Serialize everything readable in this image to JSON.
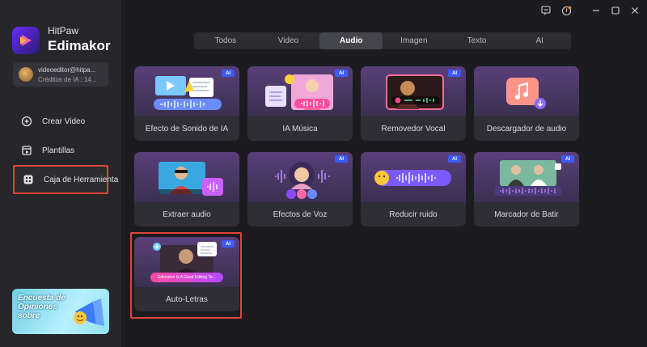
{
  "brand": {
    "line1": "HitPaw",
    "line2": "Edimakor"
  },
  "account": {
    "email": "videoeditor@hitpa...",
    "credits": "Créditos de IA : 14..."
  },
  "nav": [
    {
      "label": "Crear Video",
      "icon": "add-video-icon"
    },
    {
      "label": "Plantillas",
      "icon": "templates-icon"
    },
    {
      "label": "Caja de Herramienta",
      "icon": "toolbox-icon",
      "active": true
    }
  ],
  "promo": {
    "text": "Encuesta de Opiniones sobre"
  },
  "window_controls": [
    "feedback-icon",
    "notification-icon",
    "minimize-icon",
    "maximize-icon",
    "close-icon"
  ],
  "tabs": [
    {
      "label": "Todos"
    },
    {
      "label": "Video"
    },
    {
      "label": "Audio",
      "active": true
    },
    {
      "label": "Imagen"
    },
    {
      "label": "Texto"
    },
    {
      "label": "AI"
    }
  ],
  "badge_label": "AI",
  "tools": [
    {
      "name": "Efecto de Sonido de IA",
      "ai": true
    },
    {
      "name": "IA Música",
      "ai": true
    },
    {
      "name": "Removedor Vocal",
      "ai": true
    },
    {
      "name": "Descargador de audio",
      "ai": false
    },
    {
      "name": "Extraer audio",
      "ai": false
    },
    {
      "name": "Efectos de Voz",
      "ai": true
    },
    {
      "name": "Reducir ruido",
      "ai": true
    },
    {
      "name": "Marcador de Batir",
      "ai": true
    },
    {
      "name": "Auto-Letras",
      "ai": true,
      "selected": true,
      "subtitle_sample": "Edimakor Is A Good Editing To..."
    }
  ],
  "colors": {
    "accent": "#3b5bff",
    "selection": "#e0443a",
    "background": "#1c1c20",
    "sidebar": "#26262b"
  }
}
